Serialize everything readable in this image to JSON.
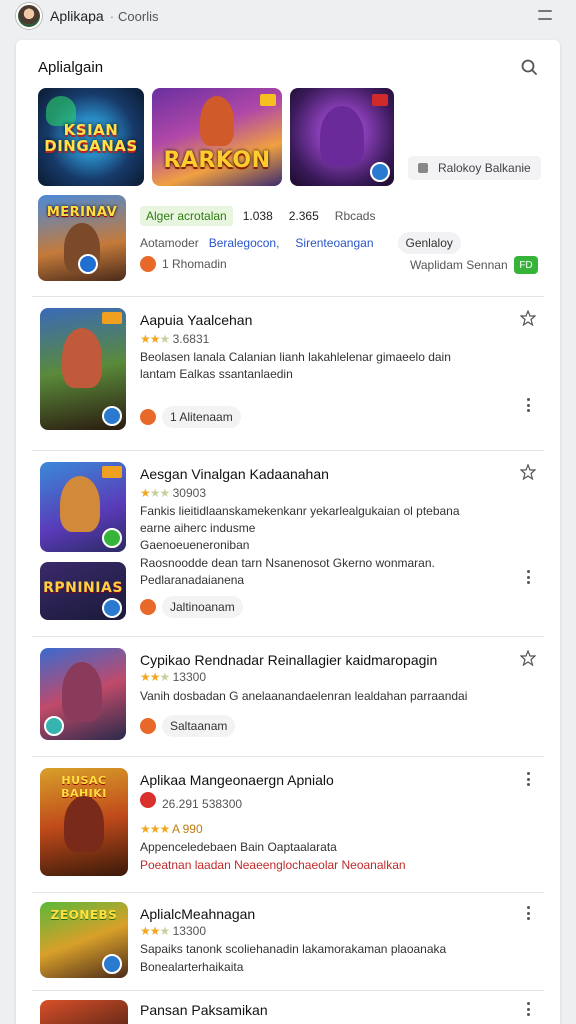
{
  "window": {
    "app_title": "Aplikapa",
    "separator": "·",
    "app_sub": "Coorlis"
  },
  "card": {
    "title": "Aplialgain"
  },
  "thumbs": {
    "t1_text": "KSIAN DINGANAS",
    "t2_text": "RARKON"
  },
  "side_chip": "Ralokoy Balkanie",
  "featured": {
    "thumb_text": "MERINAV",
    "tag": "Alger acrotalan",
    "count1": "1.038",
    "count2": "2.365",
    "count3": "Rbcads",
    "line2_a": "Aotamoder",
    "line2_b": "Beralegocon,",
    "line2_c": "Sirenteoangan",
    "line2_chip": "Genlaloy",
    "line3_a": "1 Rhomadin",
    "line3_b": "Waplidam Sennan",
    "btn": "FD"
  },
  "items": [
    {
      "title": "Aapuia Yaalcehan",
      "rating": "3.6831",
      "desc1": "Beolasen lanala Calanian lianh lakahlelenar gimaeelo dain",
      "desc2": "lantam Ealkas ssantanlaedin",
      "chip": "1 Alitenaam",
      "tag": "FF"
    },
    {
      "title": "Aesgan Vinalgan Kadaanahan",
      "rating": "30903",
      "desc1": "Fankis lieitidlaanskamekenkanr yekarlealgukaian ol ptebana",
      "desc2": "earne aiherc indusme",
      "desc3": "Gaenoeueneroniban",
      "desc4": "Raosnoodde dean tarn Nsanenosot Gkerno wonmaran.",
      "desc5": "Pedlaranadaianena",
      "chip": "Jaltinoanam",
      "tag": "DT",
      "thumb2_text": "RPNINIAS"
    },
    {
      "title": "Cypikao Rendnadar Reinallagier kaidmaropagin",
      "rating": "13300",
      "desc1": "Vanih dosbadan G anelaanandaelenran lealdahan parraandai",
      "chip": "Saltaanam",
      "tag": ""
    },
    {
      "title": "Aplikaa Mangeonaergn Apnialo",
      "rating": "26.291 538300",
      "rating2": "A 990",
      "desc1": "Appenceledebaen Bain Oaptaalarata",
      "desc2": "Poeatnan laadan Neaeenglochaeolar Neoanalkan",
      "thumb_text": "HUSAC BAHIKI"
    },
    {
      "title": "AplialcMeahnagan",
      "rating": "13300",
      "desc1": "Sapaiks tanonk scoliehanadin lakamorakaman plaoanaka",
      "desc2": "Bonealarterhaikaita",
      "thumb_text": "ZEONEBS"
    },
    {
      "title": "Pansan Paksamikan"
    }
  ]
}
